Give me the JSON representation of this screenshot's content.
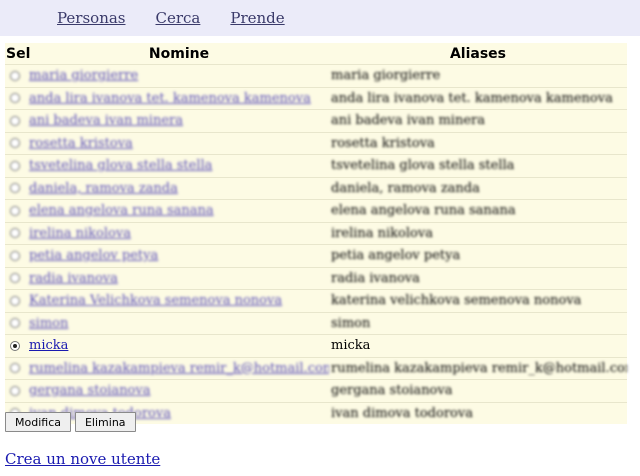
{
  "nav": {
    "items": [
      "Personas",
      "Cerca",
      "Prende"
    ]
  },
  "table": {
    "headers": {
      "sel": "Sel",
      "name": "Nomine",
      "aliases": "Aliases"
    },
    "rows": [
      {
        "name": "maria giorgierre",
        "alias": "maria giorgierre",
        "selected": false,
        "redacted": true
      },
      {
        "name": "anda lira ivanova tet. kamenova kamenova",
        "alias": "anda lira ivanova tet. kamenova kamenova",
        "selected": false,
        "redacted": true
      },
      {
        "name": "ani badeva ivan minera",
        "alias": "ani badeva ivan minera",
        "selected": false,
        "redacted": true
      },
      {
        "name": "rosetta kristova",
        "alias": "rosetta kristova",
        "selected": false,
        "redacted": true
      },
      {
        "name": "tsvetelina glova stella stella",
        "alias": "tsvetelina glova stella stella",
        "selected": false,
        "redacted": true
      },
      {
        "name": "daniela, ramova zanda",
        "alias": "daniela, ramova zanda",
        "selected": false,
        "redacted": true
      },
      {
        "name": "elena angelova runa sanana",
        "alias": "elena angelova runa sanana",
        "selected": false,
        "redacted": true
      },
      {
        "name": "irelina nikolova",
        "alias": "irelina nikolova",
        "selected": false,
        "redacted": true
      },
      {
        "name": "petia angelov petya",
        "alias": "petia angelov petya",
        "selected": false,
        "redacted": true
      },
      {
        "name": "radia ivanova",
        "alias": "radia ivanova",
        "selected": false,
        "redacted": true
      },
      {
        "name": "Katerina Velichkova semenova nonova",
        "alias": "katerina velichkova semenova nonova",
        "selected": false,
        "redacted": true
      },
      {
        "name": "simon",
        "alias": "simon",
        "selected": false,
        "redacted": true
      },
      {
        "name": "micka",
        "alias": "micka",
        "selected": true,
        "redacted": false
      },
      {
        "name": "rumelina kazakampieva remir_k@hotmail.com",
        "alias": "rumelina kazakampieva remir_k@hotmail.com",
        "selected": false,
        "redacted": true
      },
      {
        "name": "gergana stoianova",
        "alias": "gergana stoianova",
        "selected": false,
        "redacted": true
      },
      {
        "name": "ivan dimova todorova",
        "alias": "ivan dimova todorova",
        "selected": false,
        "redacted": true
      }
    ]
  },
  "buttons": {
    "modify": "Modifica",
    "delete": "Elimina"
  },
  "create_link": "Crea un nove utente"
}
